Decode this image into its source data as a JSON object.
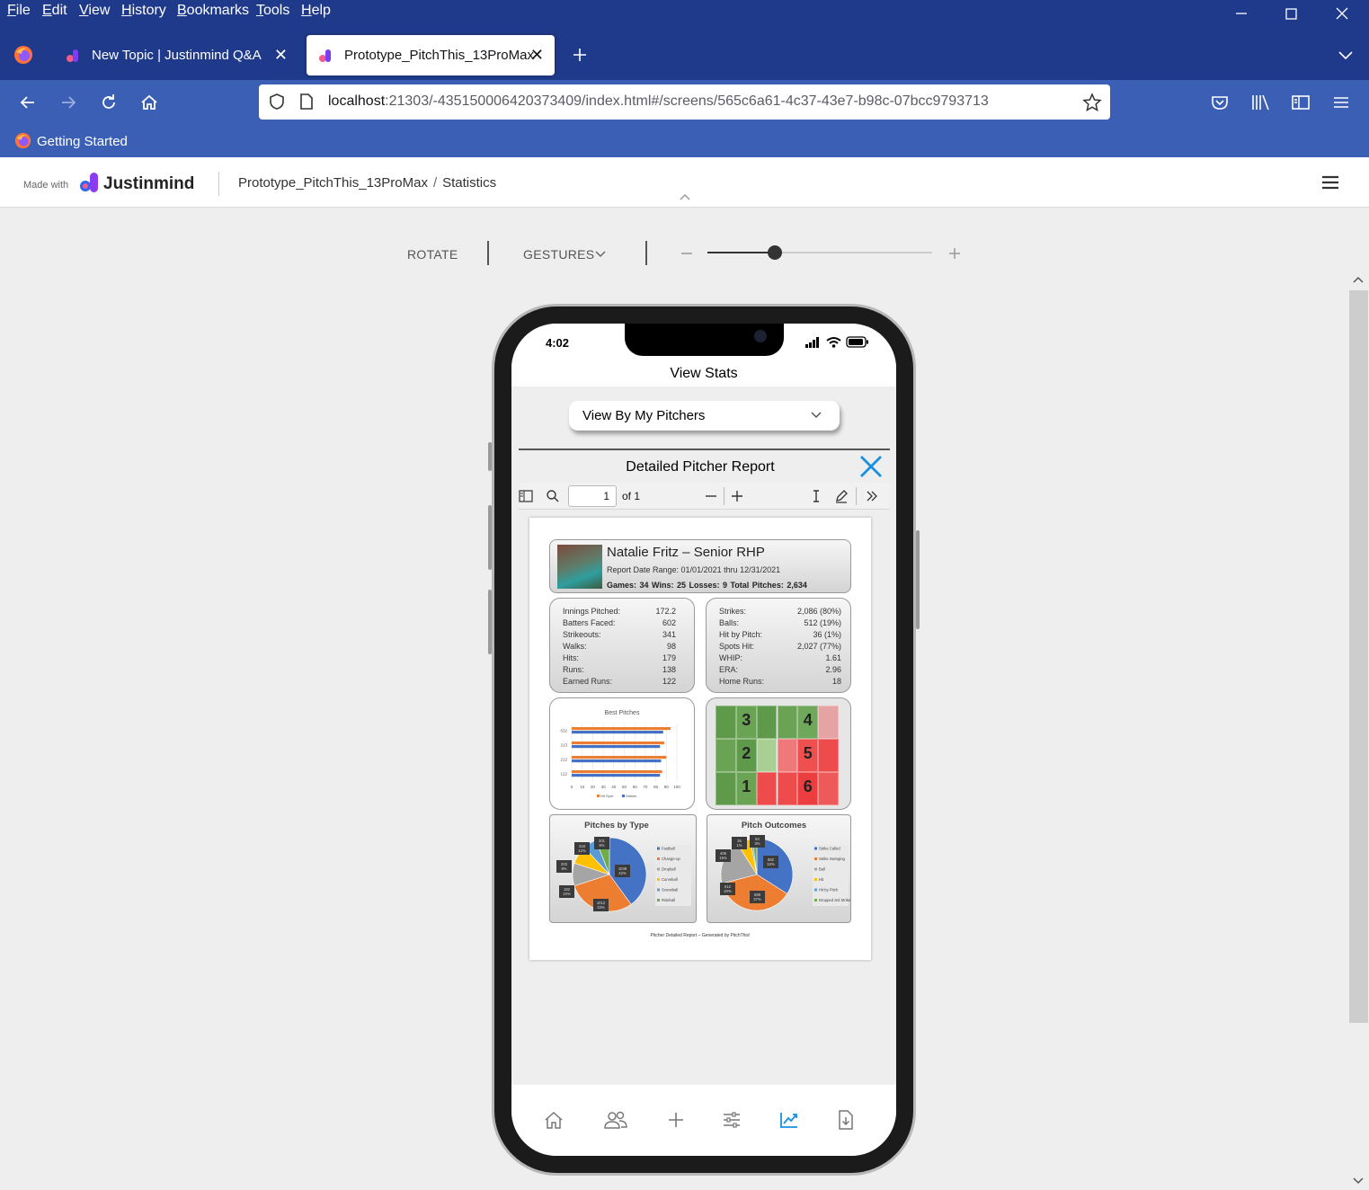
{
  "browser": {
    "menu": [
      "File",
      "Edit",
      "View",
      "History",
      "Bookmarks",
      "Tools",
      "Help"
    ],
    "tabs": [
      {
        "title": "New Topic | Justinmind Q&A",
        "active": false
      },
      {
        "title": "Prototype_PitchThis_13ProMax",
        "active": true
      }
    ],
    "url_host": "localhost",
    "url_rest": ":21303/-435150006420373409/index.html#/screens/565c6a61-4c37-43e7-b98c-07bcc9793713",
    "bookmark": "Getting Started"
  },
  "jim": {
    "made_with": "Made with",
    "brand": "Justinmind",
    "project": "Prototype_PitchThis_13ProMax",
    "separator": "/",
    "screen": "Statistics"
  },
  "sim": {
    "rotate": "ROTATE",
    "gestures": "GESTURES",
    "zoom_level": 0.3
  },
  "phone": {
    "time": "4:02",
    "title": "View Stats",
    "dropdown": "View By My Pitchers",
    "report_title": "Detailed Pitcher Report",
    "pdf": {
      "page": "1",
      "of": "of 1"
    },
    "report": {
      "name": "Natalie Fritz – Senior RHP",
      "range": "Report Date Range: 01/01/2021 thru 12/31/2021",
      "totals": "Games: 34   Wins: 25   Losses: 9   Total Pitches: 2,634",
      "left_stats": [
        {
          "k": "Innings Pitched:",
          "v": "172.2"
        },
        {
          "k": "Batters Faced:",
          "v": "602"
        },
        {
          "k": "Strikeouts:",
          "v": "341"
        },
        {
          "k": "Walks:",
          "v": "98"
        },
        {
          "k": "Hits:",
          "v": "179"
        },
        {
          "k": "Runs:",
          "v": "138"
        },
        {
          "k": "Earned Runs:",
          "v": "122"
        }
      ],
      "right_stats": [
        {
          "k": "Strikes:",
          "v": "2,086",
          "p": "(80%)"
        },
        {
          "k": "Balls:",
          "v": "512",
          "p": "(19%)"
        },
        {
          "k": "Hit by Pitch:",
          "v": "36",
          "p": "(1%)"
        },
        {
          "k": "Spots Hit:",
          "v": "2,027",
          "p": "(77%)"
        },
        {
          "k": "WHIP:",
          "v": "1.61",
          "p": ""
        },
        {
          "k": "ERA:",
          "v": "2.96",
          "p": ""
        },
        {
          "k": "Home Runs:",
          "v": "18",
          "p": ""
        }
      ],
      "best_pitches": {
        "title": "Best Pitches",
        "categories": [
          "632",
          "213",
          "212",
          "122"
        ],
        "series": [
          {
            "name": "Hit Spot",
            "values": [
              94,
              88,
              90,
              86
            ],
            "color": "#ed7d31"
          },
          {
            "name": "Strikes",
            "values": [
              87,
              84,
              85,
              84
            ],
            "color": "#4472c4"
          }
        ],
        "ticks": [
          "0",
          "10",
          "20",
          "30",
          "40",
          "50",
          "60",
          "70",
          "80",
          "90",
          "100"
        ]
      },
      "heatmap": {
        "labels": [
          "3",
          "4",
          "2",
          "5",
          "1",
          "6"
        ]
      },
      "pitches_by_type": {
        "title": "Pitches by Type",
        "legend": [
          "Fastball",
          "Change-up",
          "Dropball",
          "Curveball",
          "Screwball",
          "Riseball"
        ],
        "labels": [
          "1049\n42%",
          "1012\n33%",
          "182\n10%",
          "203\n8%",
          "318\n12%",
          "201\n6%"
        ]
      },
      "pitch_outcomes": {
        "title": "Pitch Outcomes",
        "legend": [
          "Strike Called",
          "Strike Swinging",
          "Ball",
          "Hit",
          "Hit by Pitch",
          "Dropped 3rd Strike"
        ],
        "labels": [
          "882\n34%",
          "888\n37%",
          "512\n20%",
          "408\n15%",
          "35\n1%",
          "84\n3%"
        ]
      },
      "footer": "Pitcher Detailed Report – Generated by PitchThis!"
    }
  }
}
